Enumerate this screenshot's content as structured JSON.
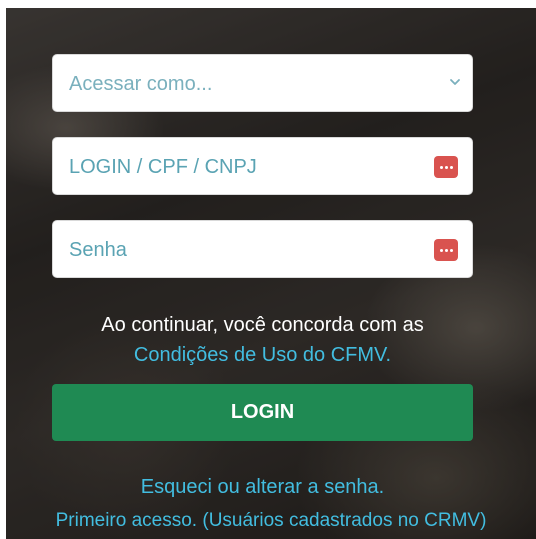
{
  "form": {
    "role_select": {
      "placeholder": "Acessar como...",
      "icon": "chevron-down-icon"
    },
    "login_input": {
      "placeholder": "LOGIN / CPF / CNPJ",
      "icon": "password-dots-icon"
    },
    "password_input": {
      "placeholder": "Senha",
      "icon": "password-dots-icon"
    },
    "agreement_text": "Ao continuar, você concorda com as",
    "terms_link": "Condições de Uso do CFMV.",
    "login_button": "LOGIN",
    "forgot_link": "Esqueci ou alterar a senha.",
    "first_access_link": "Primeiro acesso. (Usuários cadastrados no CRMV)"
  },
  "colors": {
    "accent_button": "#1f8a53",
    "link": "#42bde0",
    "badge": "#d9534f",
    "placeholder": "#5aa3b3"
  }
}
